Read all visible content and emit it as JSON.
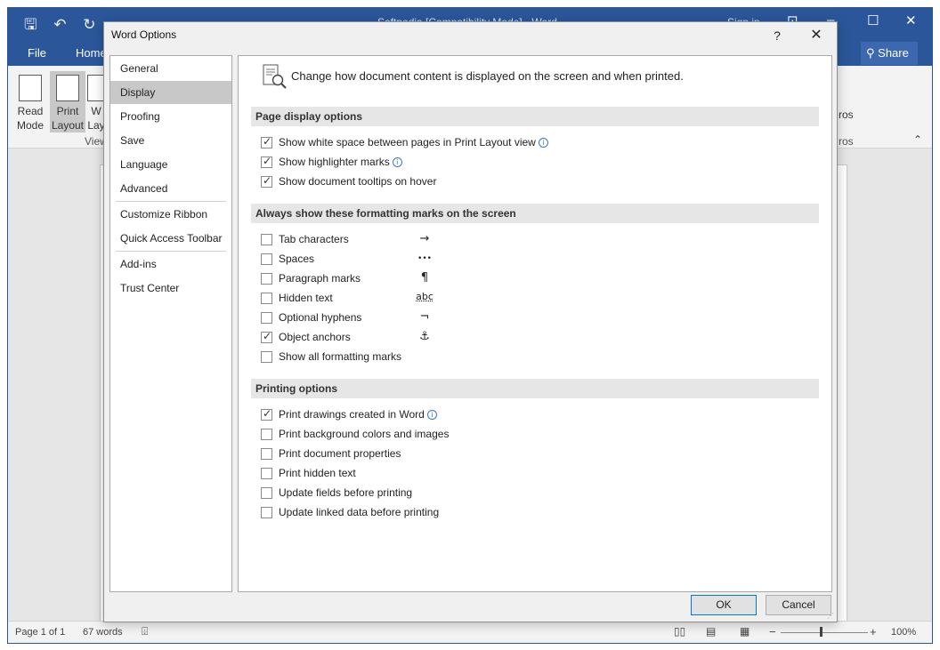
{
  "word": {
    "title": "Softpedia [Compatibility Mode] - Word",
    "user": "Sign in",
    "tabs": [
      "File",
      "Home"
    ],
    "share_label": "Share",
    "ribbon": {
      "read_mode": [
        "Read",
        "Mode"
      ],
      "print_layout": [
        "Print",
        "Layout"
      ],
      "web_layout": [
        "W",
        "Lay"
      ],
      "group_label": "View",
      "macros_label": "ros",
      "macros_group": "ros"
    },
    "status": {
      "page": "Page 1 of 1",
      "words": "67 words",
      "zoom": "100%"
    }
  },
  "dialog": {
    "title": "Word Options",
    "help": "?",
    "close": "✕",
    "nav": [
      {
        "label": "General",
        "selected": false
      },
      {
        "label": "Display",
        "selected": true
      },
      {
        "label": "Proofing",
        "selected": false
      },
      {
        "label": "Save",
        "selected": false
      },
      {
        "label": "Language",
        "selected": false
      },
      {
        "label": "Advanced",
        "selected": false
      },
      {
        "label": "Customize Ribbon",
        "selected": false
      },
      {
        "label": "Quick Access Toolbar",
        "selected": false
      },
      {
        "label": "Add-ins",
        "selected": false
      },
      {
        "label": "Trust Center",
        "selected": false
      }
    ],
    "header_text": "Change how document content is displayed on the screen and when printed.",
    "sections": {
      "page_display": {
        "title": "Page display options",
        "options": [
          {
            "label": "Show white space between pages in Print Layout view",
            "checked": true,
            "info": true
          },
          {
            "label": "Show highlighter marks",
            "checked": true,
            "info": true
          },
          {
            "label": "Show document tooltips on hover",
            "checked": true,
            "info": false
          }
        ]
      },
      "formatting_marks": {
        "title": "Always show these formatting marks on the screen",
        "options": [
          {
            "label": "Tab characters",
            "checked": false,
            "symbol": "→"
          },
          {
            "label": "Spaces",
            "checked": false,
            "symbol": "•••"
          },
          {
            "label": "Paragraph marks",
            "checked": false,
            "symbol": "¶"
          },
          {
            "label": "Hidden text",
            "checked": false,
            "symbol": "abc"
          },
          {
            "label": "Optional hyphens",
            "checked": false,
            "symbol": "¬"
          },
          {
            "label": "Object anchors",
            "checked": true,
            "symbol": "⚓"
          },
          {
            "label": "Show all formatting marks",
            "checked": false,
            "symbol": ""
          }
        ]
      },
      "printing": {
        "title": "Printing options",
        "options": [
          {
            "label": "Print drawings created in Word",
            "checked": true,
            "info": true
          },
          {
            "label": "Print background colors and images",
            "checked": false,
            "info": false
          },
          {
            "label": "Print document properties",
            "checked": false,
            "info": false
          },
          {
            "label": "Print hidden text",
            "checked": false,
            "info": false
          },
          {
            "label": "Update fields before printing",
            "checked": false,
            "info": false
          },
          {
            "label": "Update linked data before printing",
            "checked": false,
            "info": false
          }
        ]
      }
    },
    "ok_label": "OK",
    "cancel_label": "Cancel"
  },
  "colors": {
    "accent": "#2b579a",
    "selected_nav": "#c8c8c8",
    "info": "#3a78c8"
  }
}
